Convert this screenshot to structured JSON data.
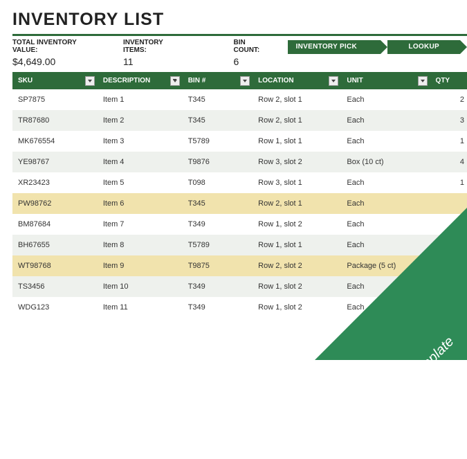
{
  "title": "INVENTORY LIST",
  "summary": {
    "total_label": "TOTAL INVENTORY VALUE:",
    "total_value": "$4,649.00",
    "items_label": "INVENTORY ITEMS:",
    "items_value": "11",
    "bins_label": "BIN COUNT:",
    "bins_value": "6"
  },
  "tabs": {
    "picklist": "INVENTORY PICK LIST",
    "lookup": "LOOKUP"
  },
  "columns": {
    "sku": "SKU",
    "description": "DESCRIPTION",
    "bin": "BIN #",
    "location": "LOCATION",
    "unit": "UNIT",
    "qty": "QTY"
  },
  "rows": [
    {
      "sku": "SP7875",
      "description": "Item 1",
      "bin": "T345",
      "location": "Row 2, slot 1",
      "unit": "Each",
      "qty": "2",
      "hl": false
    },
    {
      "sku": "TR87680",
      "description": "Item 2",
      "bin": "T345",
      "location": "Row 2, slot 1",
      "unit": "Each",
      "qty": "3",
      "hl": false
    },
    {
      "sku": "MK676554",
      "description": "Item 3",
      "bin": "T5789",
      "location": "Row 1, slot 1",
      "unit": "Each",
      "qty": "1",
      "hl": false
    },
    {
      "sku": "YE98767",
      "description": "Item 4",
      "bin": "T9876",
      "location": "Row 3, slot 2",
      "unit": "Box (10 ct)",
      "qty": "4",
      "hl": false
    },
    {
      "sku": "XR23423",
      "description": "Item 5",
      "bin": "T098",
      "location": "Row 3, slot 1",
      "unit": "Each",
      "qty": "1",
      "hl": false
    },
    {
      "sku": "PW98762",
      "description": "Item 6",
      "bin": "T345",
      "location": "Row 2, slot 1",
      "unit": "Each",
      "qty": "",
      "hl": true
    },
    {
      "sku": "BM87684",
      "description": "Item 7",
      "bin": "T349",
      "location": "Row 1, slot 2",
      "unit": "Each",
      "qty": "",
      "hl": false
    },
    {
      "sku": "BH67655",
      "description": "Item 8",
      "bin": "T5789",
      "location": "Row 1, slot 1",
      "unit": "Each",
      "qty": "",
      "hl": false
    },
    {
      "sku": "WT98768",
      "description": "Item 9",
      "bin": "T9875",
      "location": "Row 2, slot 2",
      "unit": "Package (5 ct)",
      "qty": "",
      "hl": true
    },
    {
      "sku": "TS3456",
      "description": "Item 10",
      "bin": "T349",
      "location": "Row 1, slot 2",
      "unit": "Each",
      "qty": "",
      "hl": false
    },
    {
      "sku": "WDG123",
      "description": "Item 11",
      "bin": "T349",
      "location": "Row 1, slot 2",
      "unit": "Each",
      "qty": "",
      "hl": false
    }
  ],
  "badge_text": "Accessible Template"
}
